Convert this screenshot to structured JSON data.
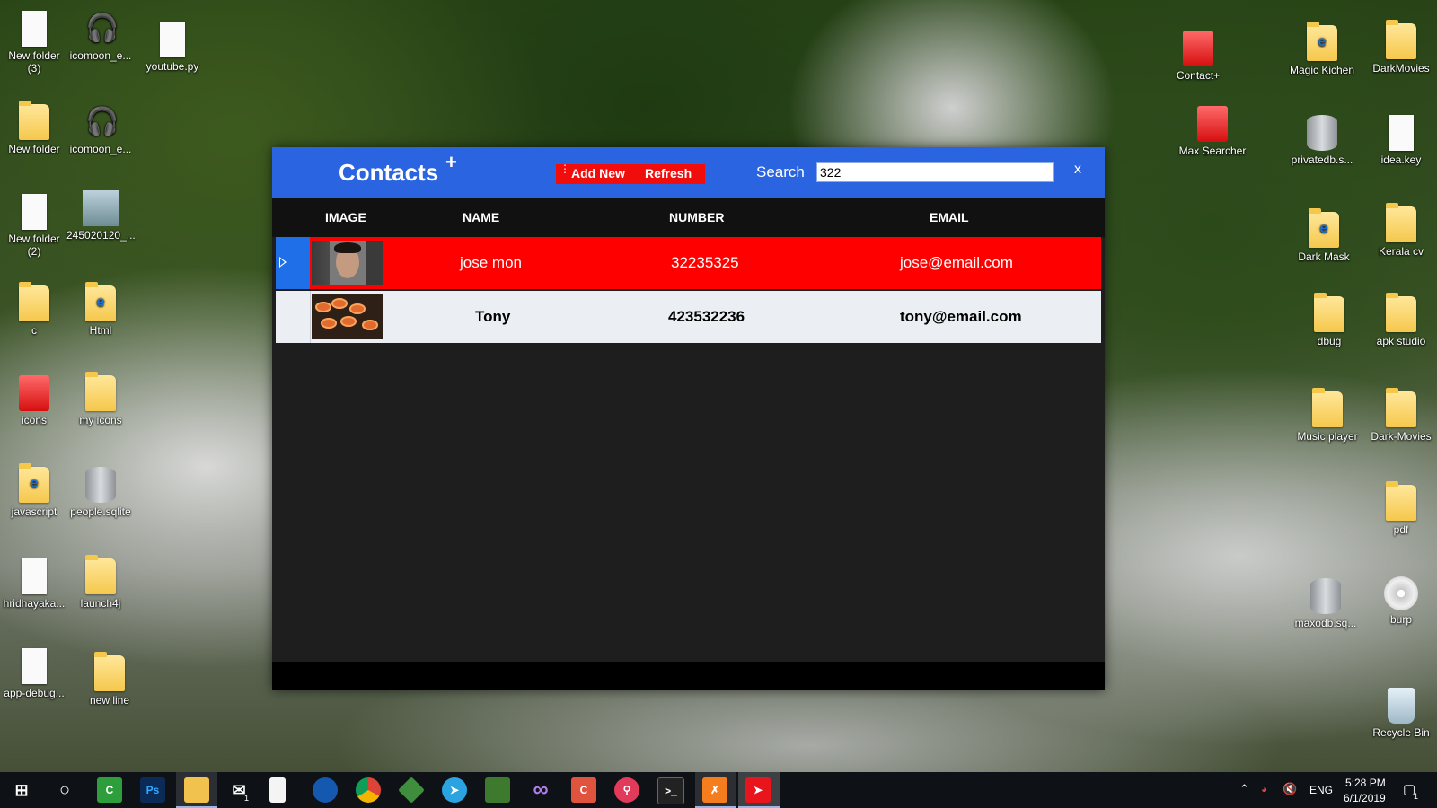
{
  "desktop": {
    "left_icons": [
      {
        "label": "New folder\n(3)"
      },
      {
        "label": "icomoon_e..."
      },
      {
        "label": "youtube.py"
      },
      {
        "label": "New folder"
      },
      {
        "label": "icomoon_e..."
      },
      {
        "label": "New folder\n(2)"
      },
      {
        "label": "245020120_..."
      },
      {
        "label": "c"
      },
      {
        "label": "Html"
      },
      {
        "label": "icons"
      },
      {
        "label": "my icons"
      },
      {
        "label": "javascript"
      },
      {
        "label": "people.sqlite"
      },
      {
        "label": "hridhayaka..."
      },
      {
        "label": "launch4j"
      },
      {
        "label": "app-debug..."
      },
      {
        "label": "new line"
      }
    ],
    "right_icons": [
      {
        "label": "Contact+"
      },
      {
        "label": "Magic Kichen"
      },
      {
        "label": "DarkMovies"
      },
      {
        "label": "Max Searcher"
      },
      {
        "label": "privatedb.s..."
      },
      {
        "label": "idea.key"
      },
      {
        "label": "Dark Mask"
      },
      {
        "label": "Kerala cv"
      },
      {
        "label": "dbug"
      },
      {
        "label": "apk studio"
      },
      {
        "label": "Music player"
      },
      {
        "label": "Dark-Movies"
      },
      {
        "label": "pdf"
      },
      {
        "label": "maxodb.sq..."
      },
      {
        "label": "burp"
      },
      {
        "label": "Recycle Bin"
      }
    ]
  },
  "app": {
    "title": "Contacts",
    "title_plus": "+",
    "add_new_label": "Add New",
    "refresh_label": "Refresh",
    "search_label": "Search",
    "search_value": "322",
    "close_label": "x",
    "columns": {
      "image": "IMAGE",
      "name": "NAME",
      "number": "NUMBER",
      "email": "EMAIL"
    },
    "rows": [
      {
        "name": "jose mon",
        "number": "32235325",
        "email": "jose@email.com",
        "selected": true
      },
      {
        "name": "Tony",
        "number": "423532236",
        "email": "tony@email.com",
        "selected": false
      }
    ],
    "colors": {
      "header": "#2a64e0",
      "selected_row": "#fe0000",
      "button_group": "#f20d0d",
      "body": "#1e1e1e"
    }
  },
  "taskbar": {
    "ps_label": "Ps",
    "language": "ENG",
    "time": "5:28 PM",
    "date": "6/1/2019",
    "mail_badge": "1",
    "notification_badge": "1"
  }
}
